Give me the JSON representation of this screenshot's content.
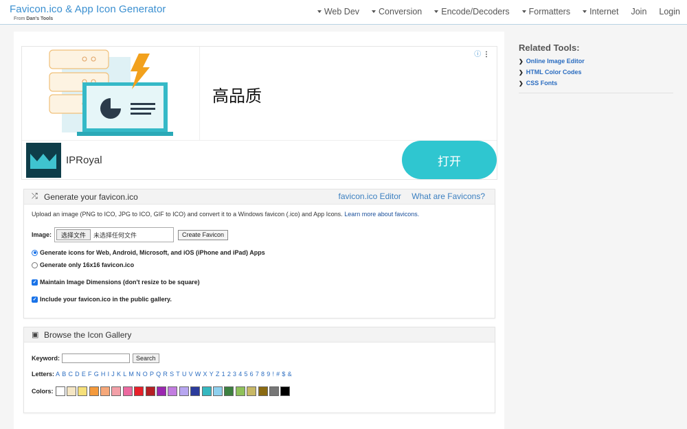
{
  "navbar": {
    "title": "Favicon.ico & App Icon Generator",
    "subtitle_prefix": "From",
    "subtitle_brand": "Dan's Tools",
    "items": [
      {
        "label": "Web Dev",
        "has_caret": true
      },
      {
        "label": "Conversion",
        "has_caret": true
      },
      {
        "label": "Encode/Decoders",
        "has_caret": true
      },
      {
        "label": "Formatters",
        "has_caret": true
      },
      {
        "label": "Internet",
        "has_caret": true
      },
      {
        "label": "Join",
        "has_caret": false
      },
      {
        "label": "Login",
        "has_caret": false
      }
    ]
  },
  "ad": {
    "headline": "高品质",
    "brand": "IPRoyal",
    "cta": "打开",
    "info_icon": "ⓘ",
    "menu_icon": "⋮"
  },
  "generator": {
    "title": "Generate your favicon.ico",
    "links": [
      "favicon.ico Editor",
      "What are Favicons?"
    ],
    "description": "Upload an image (PNG to ICO, JPG to ICO, GIF to ICO) and convert it to a Windows favicon (.ico) and App Icons.",
    "learn_more": "Learn more about favicons.",
    "image_label": "Image:",
    "file_button": "选择文件",
    "file_status": "未选择任何文件",
    "create_button": "Create Favicon",
    "options": {
      "gen_all": {
        "label": "Generate icons for Web, Android, Microsoft, and iOS (iPhone and iPad) Apps",
        "checked": true
      },
      "gen_16": {
        "label": "Generate only 16x16 favicon.ico",
        "checked": false
      },
      "maintain": {
        "label": "Maintain Image Dimensions (don't resize to be square)",
        "checked": true
      },
      "gallery": {
        "label": "Include your favicon.ico in the public gallery.",
        "checked": true
      }
    }
  },
  "gallery": {
    "title": "Browse the Icon Gallery",
    "keyword_label": "Keyword:",
    "keyword_value": "",
    "search_button": "Search",
    "letters_label": "Letters:",
    "letters": [
      "A",
      "B",
      "C",
      "D",
      "E",
      "F",
      "G",
      "H",
      "I",
      "J",
      "K",
      "L",
      "M",
      "N",
      "O",
      "P",
      "Q",
      "R",
      "S",
      "T",
      "U",
      "V",
      "W",
      "X",
      "Y",
      "Z",
      "1",
      "2",
      "3",
      "4",
      "5",
      "6",
      "7",
      "8",
      "9",
      "!",
      "#",
      "$",
      "&"
    ],
    "colors_label": "Colors:",
    "colors": [
      "#ffffff",
      "#f5e6c4",
      "#f6e07a",
      "#f49a3c",
      "#f6a87a",
      "#f3a0a8",
      "#ec6aa0",
      "#e8202a",
      "#b51f24",
      "#9b27b0",
      "#c27de0",
      "#b7a6f0",
      "#2b3b9c",
      "#36b8c0",
      "#8fd0ee",
      "#3d8040",
      "#8fc15a",
      "#c8b866",
      "#8a6a12",
      "#777777",
      "#000000"
    ]
  },
  "sidebar": {
    "title": "Related Tools:",
    "items": [
      "Online Image Editor",
      "HTML Color Codes",
      "CSS Fonts"
    ]
  }
}
